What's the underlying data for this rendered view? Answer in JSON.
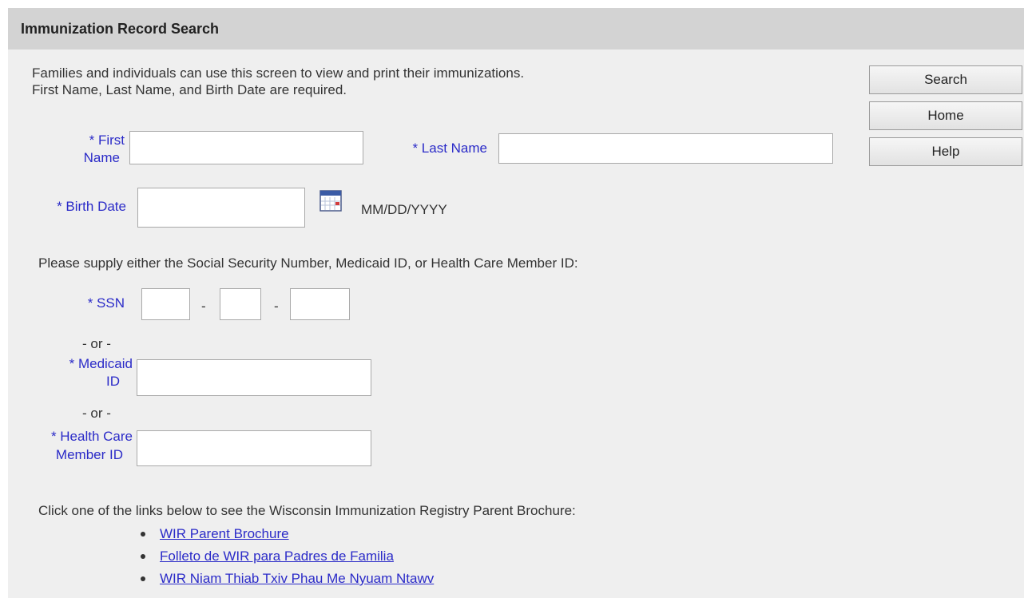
{
  "header": {
    "title": "Immunization Record Search"
  },
  "intro": {
    "line1": "Families and individuals can use this screen to view and print their immunizations.",
    "line2": "First Name, Last Name, and Birth Date are required."
  },
  "buttons": {
    "search": "Search",
    "home": "Home",
    "help": "Help"
  },
  "form": {
    "first_name": {
      "label1": "* First",
      "label2": "Name",
      "value": ""
    },
    "last_name": {
      "label": "* Last Name",
      "value": ""
    },
    "birth_date": {
      "label": "* Birth Date",
      "value": "",
      "format_hint": "MM/DD/YYYY"
    },
    "supply_text": "Please supply either the Social Security Number, Medicaid ID, or Health Care Member ID:",
    "ssn": {
      "label": "* SSN",
      "part1": "",
      "part2": "",
      "part3": "",
      "dash": "-"
    },
    "or_text": "- or -",
    "medicaid": {
      "label1": "* Medicaid",
      "label2": "ID",
      "value": ""
    },
    "health_care": {
      "label1": "* Health Care",
      "label2": "Member ID",
      "value": ""
    }
  },
  "brochure": {
    "intro": "Click one of the links below to see the Wisconsin Immunization Registry Parent Brochure:",
    "links": [
      "WIR Parent Brochure",
      "Folleto de WIR para Padres de Familia",
      "WIR Niam Thiab Txiv Phau Me Nyuam Ntawv"
    ]
  },
  "icons": {
    "calendar": "calendar-icon",
    "bullet": "bullet-icon"
  },
  "colors": {
    "label_blue": "#2b2bc8",
    "header_bg": "#d3d3d3",
    "page_bg": "#efefef"
  }
}
